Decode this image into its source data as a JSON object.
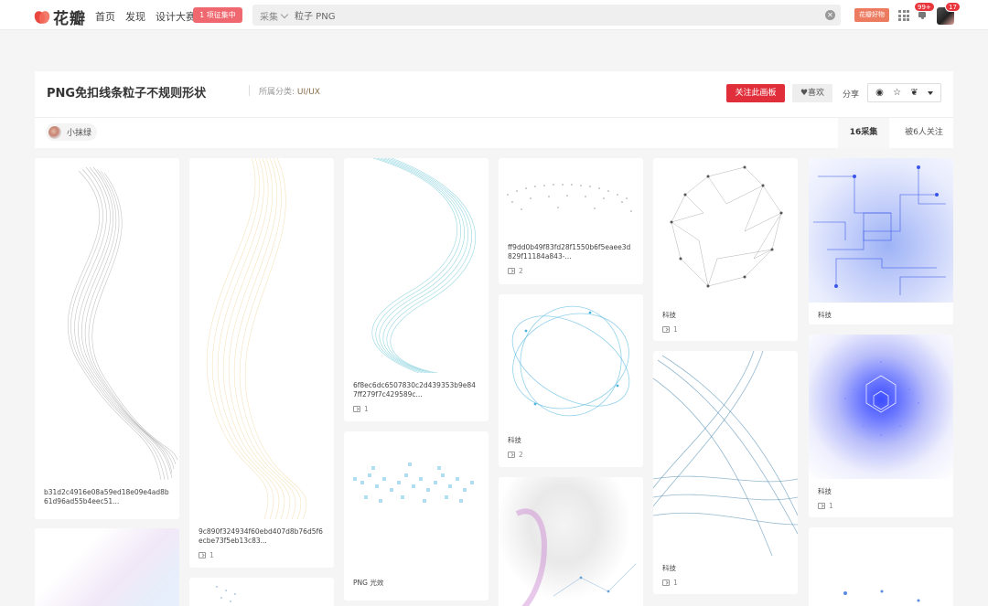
{
  "topbar": {
    "logo_text": "花瓣",
    "nav": [
      "首页",
      "发现",
      "设计大赛"
    ],
    "contest_badge": "1 项征集中",
    "search_scope": "采集",
    "search_value": "粒子 PNG",
    "good_shop": "花瓣好物",
    "bell_count": "99+",
    "avatar_count": "17"
  },
  "board": {
    "title": "PNG免扣线条粒子不规则形状",
    "category_label": "所属分类:",
    "category_value": "UI/UX",
    "follow_label": "关注此画板",
    "like_label": "喜欢",
    "share_label": "分享",
    "owner_name": "小抹绿",
    "tab_pins": "16采集",
    "tab_followers": "被6人关注"
  },
  "pins": [
    {
      "desc": "b31d2c4916e08a59ed18e09e4ad8b61d96ad55b4eec51...",
      "repins": ""
    },
    {
      "desc": "",
      "repins": ""
    },
    {
      "desc": "9c890f324934f60ebd407d8b76d5f6ecbe73f5eb13c83...",
      "repins": "1"
    },
    {
      "desc": "",
      "repins": ""
    },
    {
      "desc": "6f8ec6dc6507830c2d439353b9e847ff279f7c429589c...",
      "repins": "1"
    },
    {
      "desc": "PNG 光效",
      "repins": ""
    },
    {
      "desc": "ff9dd0b49f83fd28f1550b6f5eaee3d829f11184a843-...",
      "repins": "2"
    },
    {
      "desc": "科技",
      "repins": "2"
    },
    {
      "desc": "",
      "repins": ""
    },
    {
      "desc": "科技",
      "repins": "1"
    },
    {
      "desc": "科技",
      "repins": "1"
    },
    {
      "desc": "科技",
      "repins": ""
    },
    {
      "desc": "科技",
      "repins": "1"
    },
    {
      "desc": "",
      "repins": ""
    }
  ],
  "colors": {
    "brand_red": "#e02f3b",
    "bg": "#f5f5f5"
  }
}
